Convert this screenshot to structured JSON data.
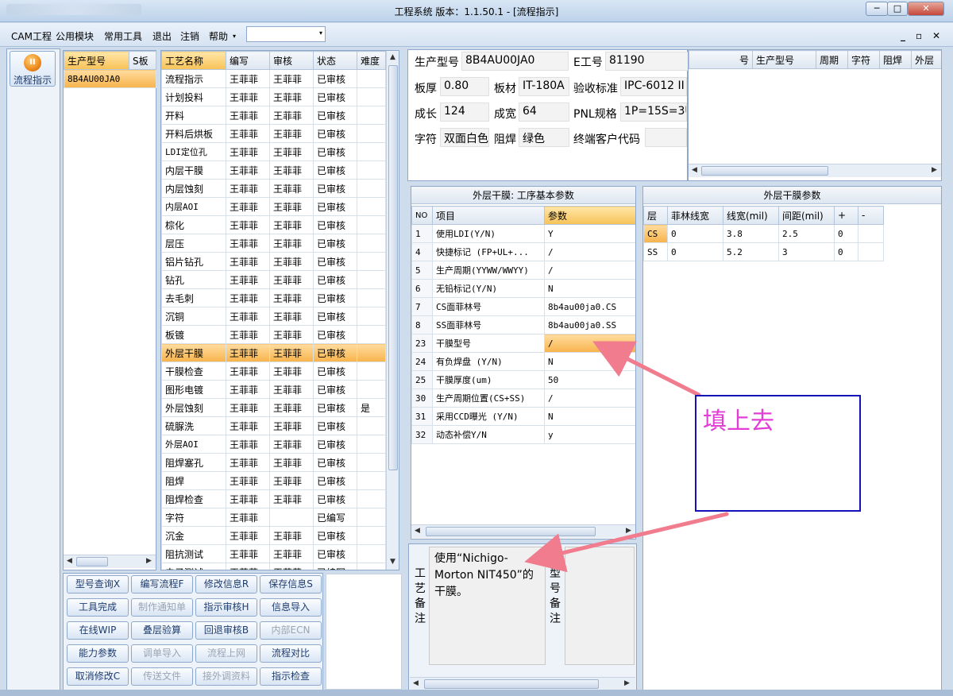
{
  "window": {
    "title": "工程系统   版本：1.1.50.1 - [流程指示]",
    "min": "─",
    "max": "□",
    "close": "✕"
  },
  "menu": {
    "items": [
      "CAM工程",
      "公用模块",
      "常用工具",
      "退出",
      "注销",
      "帮助"
    ],
    "help_arrow": "▾",
    "combo_arrow": "▾",
    "mdi": [
      "_",
      "▫",
      "✕"
    ]
  },
  "sidebar": {
    "button": "流程指示"
  },
  "models": {
    "headers": [
      "生产型号",
      "S板"
    ],
    "rows": [
      [
        "8B4AU00JA0",
        ""
      ]
    ]
  },
  "process": {
    "headers": [
      "工艺名称",
      "编写",
      "审核",
      "状态",
      "难度"
    ],
    "rows": [
      [
        "流程指示",
        "王菲菲",
        "王菲菲",
        "已审核",
        ""
      ],
      [
        "计划投料",
        "王菲菲",
        "王菲菲",
        "已审核",
        ""
      ],
      [
        "开料",
        "王菲菲",
        "王菲菲",
        "已审核",
        ""
      ],
      [
        "开料后烘板",
        "王菲菲",
        "王菲菲",
        "已审核",
        ""
      ],
      [
        "LDI定位孔",
        "王菲菲",
        "王菲菲",
        "已审核",
        ""
      ],
      [
        "内层干膜",
        "王菲菲",
        "王菲菲",
        "已审核",
        ""
      ],
      [
        "内层蚀刻",
        "王菲菲",
        "王菲菲",
        "已审核",
        ""
      ],
      [
        "内层AOI",
        "王菲菲",
        "王菲菲",
        "已审核",
        ""
      ],
      [
        "棕化",
        "王菲菲",
        "王菲菲",
        "已审核",
        ""
      ],
      [
        "层压",
        "王菲菲",
        "王菲菲",
        "已审核",
        ""
      ],
      [
        "铝片钻孔",
        "王菲菲",
        "王菲菲",
        "已审核",
        ""
      ],
      [
        "钻孔",
        "王菲菲",
        "王菲菲",
        "已审核",
        ""
      ],
      [
        "去毛刺",
        "王菲菲",
        "王菲菲",
        "已审核",
        ""
      ],
      [
        "沉铜",
        "王菲菲",
        "王菲菲",
        "已审核",
        ""
      ],
      [
        "板镀",
        "王菲菲",
        "王菲菲",
        "已审核",
        ""
      ],
      [
        "外层干膜",
        "王菲菲",
        "王菲菲",
        "已审核",
        ""
      ],
      [
        "干膜检查",
        "王菲菲",
        "王菲菲",
        "已审核",
        ""
      ],
      [
        "图形电镀",
        "王菲菲",
        "王菲菲",
        "已审核",
        ""
      ],
      [
        "外层蚀刻",
        "王菲菲",
        "王菲菲",
        "已审核",
        "是"
      ],
      [
        "硫脲洗",
        "王菲菲",
        "王菲菲",
        "已审核",
        ""
      ],
      [
        "外层AOI",
        "王菲菲",
        "王菲菲",
        "已审核",
        ""
      ],
      [
        "阻焊塞孔",
        "王菲菲",
        "王菲菲",
        "已审核",
        ""
      ],
      [
        "阻焊",
        "王菲菲",
        "王菲菲",
        "已审核",
        ""
      ],
      [
        "阻焊检查",
        "王菲菲",
        "王菲菲",
        "已审核",
        ""
      ],
      [
        "字符",
        "王菲菲",
        "",
        "已编写",
        ""
      ],
      [
        "沉金",
        "王菲菲",
        "王菲菲",
        "已审核",
        ""
      ],
      [
        "阻抗测试",
        "王菲菲",
        "王菲菲",
        "已审核",
        ""
      ],
      [
        "电子测试",
        "王菲菲",
        "王菲菲",
        "已编写",
        ""
      ]
    ],
    "selected_index": 15
  },
  "buttons": [
    [
      "型号查询X",
      "编写流程F",
      "修改信息R",
      "保存信息S"
    ],
    [
      "工具完成",
      "制作通知单",
      "指示审核H",
      "信息导入"
    ],
    [
      "在线WIP",
      "叠层验算",
      "回退审核B",
      "内部ECN"
    ],
    [
      "能力参数",
      "调单导入",
      "流程上网",
      "流程对比"
    ],
    [
      "取消修改C",
      "传送文件",
      "接外调资料",
      "指示检查"
    ]
  ],
  "info": {
    "labels": [
      "生产型号",
      "E工号",
      "板厚",
      "板材",
      "验收标准",
      "成长",
      "成宽",
      "PNL规格",
      "字符",
      "阻焊",
      "终端客户代码"
    ],
    "values": [
      "8B4AU00JA0",
      "81190",
      "0.80",
      "IT-180A",
      "IPC-6012 II",
      "124",
      "64",
      "1P=15S=3U",
      "双面白色",
      "绿色",
      ""
    ]
  },
  "topgrid": {
    "headers": [
      "号",
      "生产型号",
      "周期",
      "字符",
      "阻焊",
      "外层"
    ]
  },
  "params": {
    "title": "外层干膜: 工序基本参数",
    "headers": [
      "NO",
      "项目",
      "参数"
    ],
    "rows": [
      [
        "1",
        "使用LDI(Y/N)",
        "Y"
      ],
      [
        "4",
        "快捷标记 (FP+UL+...",
        "/"
      ],
      [
        "5",
        "生产周期(YYWW/WWYY)",
        "/"
      ],
      [
        "6",
        "无铅标记(Y/N)",
        "N"
      ],
      [
        "7",
        "CS面菲林号",
        "8b4au00ja0.CS"
      ],
      [
        "8",
        "SS面菲林号",
        "8b4au00ja0.SS"
      ],
      [
        "23",
        "干膜型号",
        "/"
      ],
      [
        "24",
        "有负焊盘 (Y/N)",
        "N"
      ],
      [
        "25",
        "干膜厚度(um)",
        "50"
      ],
      [
        "30",
        "生产周期位置(CS+SS)",
        "/"
      ],
      [
        "31",
        "采用CCD曝光 (Y/N)",
        "N"
      ],
      [
        "32",
        "动态补偿Y/N",
        "y"
      ]
    ]
  },
  "layer": {
    "title": "外层干膜参数",
    "headers": [
      "层",
      "菲林线宽",
      "线宽(mil)",
      "间距(mil)",
      "+",
      "-"
    ],
    "rows": [
      [
        "CS",
        "0",
        "3.8",
        "2.5",
        "0",
        ""
      ],
      [
        "SS",
        "0",
        "5.2",
        "3",
        "0",
        ""
      ]
    ]
  },
  "remarks": {
    "process_label": "工艺备注",
    "process_text": "使用“Nichigo-Morton NIT450”的干膜。",
    "model_label": "型号备注"
  },
  "annotation": {
    "text": "填上去"
  },
  "colors": {
    "accent": "#f7b34a",
    "annotation_border": "#1212b8",
    "annotation_text": "#e23ed6",
    "arrow": "#f07c8e"
  }
}
